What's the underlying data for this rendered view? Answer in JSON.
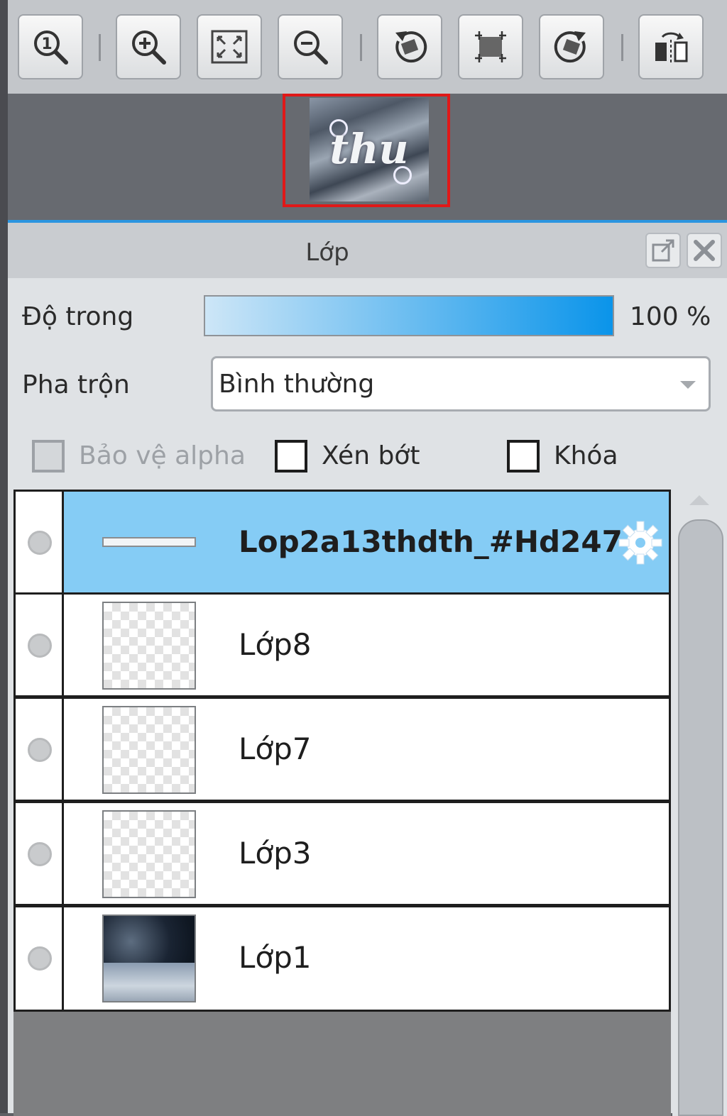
{
  "toolbar": {
    "buttons": [
      {
        "name": "zoom-actual-size-button",
        "icon": "zoom-1-icon"
      },
      {
        "name": "zoom-in-button",
        "icon": "zoom-in-icon"
      },
      {
        "name": "fit-to-window-button",
        "icon": "fit-window-icon"
      },
      {
        "name": "zoom-out-button",
        "icon": "zoom-out-icon"
      },
      {
        "name": "rotate-left-button",
        "icon": "rotate-left-icon"
      },
      {
        "name": "reset-rotation-button",
        "icon": "reset-view-icon"
      },
      {
        "name": "rotate-right-button",
        "icon": "rotate-right-icon"
      },
      {
        "name": "flip-horizontal-button",
        "icon": "flip-horizontal-icon"
      }
    ]
  },
  "navigator": {
    "thumbnail_text": "thu"
  },
  "panel": {
    "title": "Lớp",
    "opacity_label": "Độ trong",
    "opacity_value": "100 %",
    "opacity_percent": 100,
    "blend_label": "Pha trộn",
    "blend_value": "Bình thường",
    "protect_alpha_label": "Bảo vệ alpha",
    "clipping_label": "Xén bớt",
    "lock_label": "Khóa"
  },
  "layers": [
    {
      "name": "Lop2a13thdth_#Hd247",
      "selected": true,
      "thumb": "text"
    },
    {
      "name": "Lớp8",
      "selected": false,
      "thumb": "transparent"
    },
    {
      "name": "Lớp7",
      "selected": false,
      "thumb": "transparent"
    },
    {
      "name": "Lớp3",
      "selected": false,
      "thumb": "transparent"
    },
    {
      "name": "Lớp1",
      "selected": false,
      "thumb": "photo"
    }
  ],
  "colors": {
    "accent": "#2b95e0",
    "selected_row": "#85ccf5",
    "navigator_frame": "#e01818"
  }
}
